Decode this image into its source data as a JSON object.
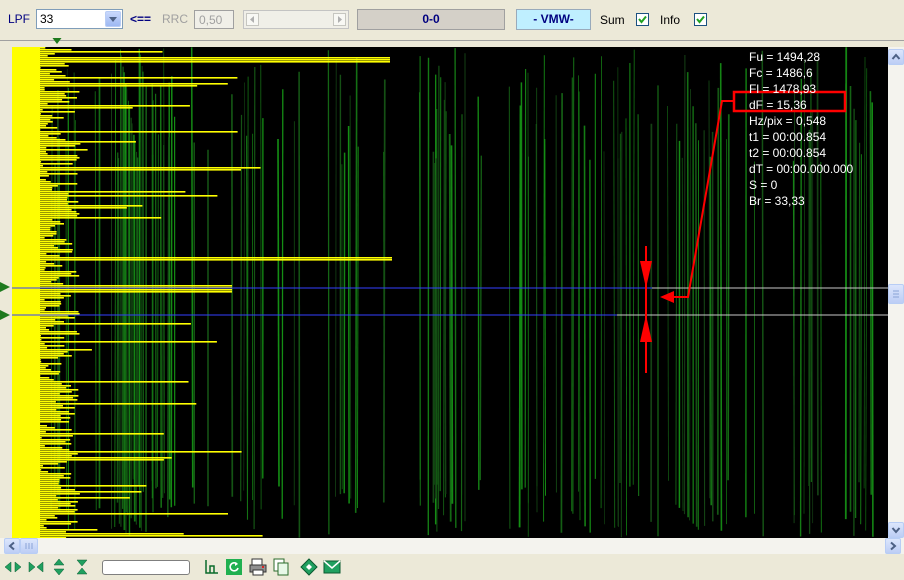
{
  "toolbar": {
    "lpf_label": "LPF",
    "lpf_value": "33",
    "arrow_label": "<==",
    "rrc_label": "RRC",
    "rrc_value": "0,50",
    "counter": "0-0",
    "mode": "- VMW-",
    "sum_label": "Sum",
    "sum_checked": true,
    "info_label": "Info",
    "info_checked": true
  },
  "info": {
    "fu": "Fu = 1494,28",
    "fc": "Fc = 1486,6",
    "fl": "Fl = 1478,93",
    "df": "dF = 15,36",
    "hzpix": "Hz/pix = 0,548",
    "t1": "t1 = 00:00.854",
    "t2": "t2 = 00:00.854",
    "dt": "dT = 00:00.000.000",
    "s": "S = 0",
    "br": "Br = 33,33"
  },
  "colors": {
    "spectrum": "#ffff00",
    "grid": "#1f7a1f",
    "cursor_line": "#3340ff",
    "annotation": "#ff0000",
    "marker": "#1e7a1e"
  },
  "icons": {
    "bottom": [
      "expand-horizontal-icon",
      "collapse-horizontal-icon",
      "expand-vertical-icon",
      "collapse-vertical-icon",
      "filter-icon",
      "refresh-icon",
      "print-icon",
      "copy-icon",
      "diamond-icon",
      "envelope-icon"
    ]
  }
}
